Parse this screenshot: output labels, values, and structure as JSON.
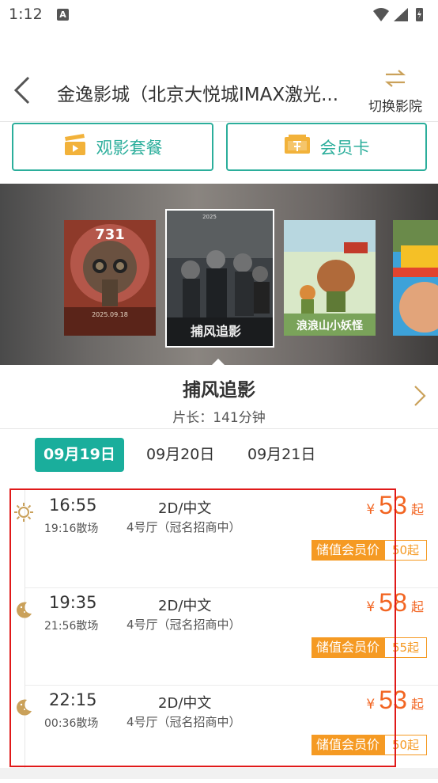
{
  "status": {
    "time": "1:12",
    "notif": "A"
  },
  "header": {
    "title": "金逸影城（北京大悦城IMAX激光...",
    "switch_label": "切换影院"
  },
  "actions": {
    "package_label": "观影套餐",
    "card_label": "会员卡"
  },
  "posters": [
    {
      "id": "poster-731",
      "text": "731",
      "sub": "2025.09.18"
    },
    {
      "id": "poster-buzhuo",
      "text": "捕风追影",
      "sub": "2025"
    },
    {
      "id": "poster-langlang",
      "text": "浪浪山小妖怪",
      "sub": ""
    },
    {
      "id": "poster-comedy",
      "text": "",
      "sub": ""
    }
  ],
  "movie": {
    "name": "捕风追影",
    "duration": "片长：141分钟"
  },
  "dates": [
    {
      "label": "09月19日",
      "active": true
    },
    {
      "label": "09月20日",
      "active": false
    },
    {
      "label": "09月21日",
      "active": false
    }
  ],
  "sessions": [
    {
      "icon": "sun-icon",
      "start": "16:55",
      "end": "19:16散场",
      "version": "2D/中文",
      "hall": "4号厅（冠名招商中）",
      "yen": "¥",
      "price": "53",
      "qi": "起",
      "member_label": "储值会员价",
      "member_price": "50起"
    },
    {
      "icon": "moon-icon",
      "start": "19:35",
      "end": "21:56散场",
      "version": "2D/中文",
      "hall": "4号厅（冠名招商中）",
      "yen": "¥",
      "price": "58",
      "qi": "起",
      "member_label": "储值会员价",
      "member_price": "55起"
    },
    {
      "icon": "moon-icon",
      "start": "22:15",
      "end": "00:36散场",
      "version": "2D/中文",
      "hall": "4号厅（冠名招商中）",
      "yen": "¥",
      "price": "53",
      "qi": "起",
      "member_label": "储值会员价",
      "member_price": "50起"
    }
  ],
  "colors": {
    "accent": "#1aae9c",
    "price": "#f26522",
    "member": "#f59a23",
    "highlight": "#e01919"
  }
}
